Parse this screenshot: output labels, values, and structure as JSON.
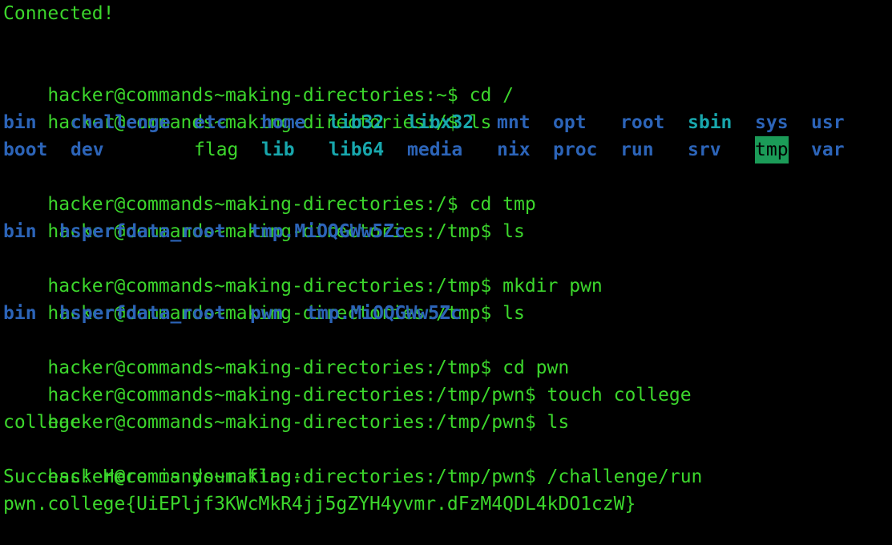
{
  "colors": {
    "background": "#000000",
    "text_green": "#3cd62c",
    "dir_blue": "#2c64b8",
    "dir_cyan": "#18a7ad",
    "highlight_bg": "#1b9b58"
  },
  "terminal": {
    "connected": "Connected!",
    "prompt_home": "hacker@commands~making-directories:~$",
    "prompt_root": "hacker@commands~making-directories:/$",
    "prompt_tmp": "hacker@commands~making-directories:/tmp$",
    "prompt_pwn": "hacker@commands~making-directories:/tmp/pwn$",
    "cmd_cd_root": "cd /",
    "cmd_ls": "ls",
    "cmd_cd_tmp": "cd tmp",
    "cmd_mkdir": "mkdir pwn",
    "cmd_cd_pwn": "cd pwn",
    "cmd_touch": "touch college",
    "cmd_run": "/challenge/run",
    "root_listing": {
      "row1": [
        "bin",
        "challenge",
        "etc",
        "home",
        "lib32",
        "libx32",
        "mnt",
        "opt",
        "root",
        "sbin",
        "sys",
        "usr"
      ],
      "row2": [
        "boot",
        "dev",
        "flag",
        "lib",
        "lib64",
        "media",
        "nix",
        "proc",
        "run",
        "srv",
        "tmp",
        "var"
      ]
    },
    "tmp_listing_1": [
      "bin",
      "hsperfdata_root",
      "tmp.MiOQGWw5Zc"
    ],
    "tmp_listing_2": [
      "bin",
      "hsperfdata_root",
      "pwn",
      "tmp.MiOQGWw5Zc"
    ],
    "pwn_listing": "college",
    "success": "Success! Here is your flag:",
    "flag": "pwn.college{UiEPljf3KWcMkR4jj5gZYH4yvmr.dFzM4QDL4kDO1czW}"
  }
}
